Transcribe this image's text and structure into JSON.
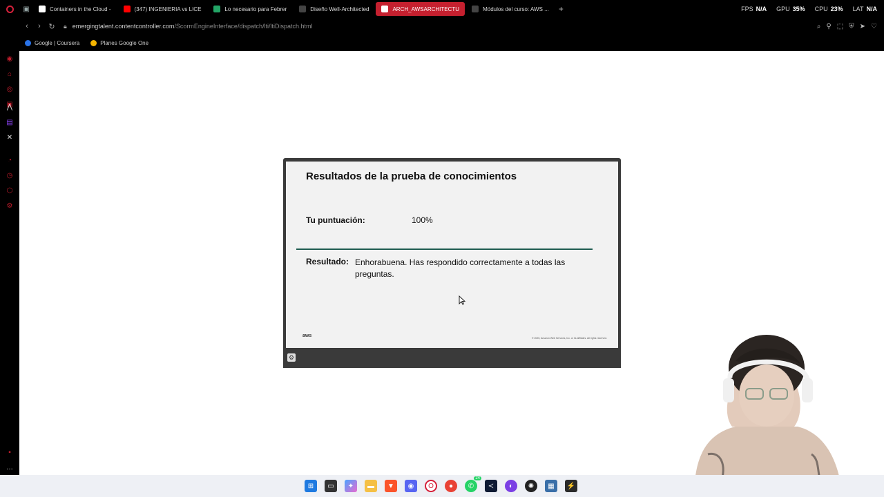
{
  "tabs": [
    {
      "label": "Containers in the Cloud -",
      "color": "#ffffff",
      "icon": "google-icon"
    },
    {
      "label": "(347) INGENIERIA vs LICE",
      "color": "#ff0000",
      "icon": "youtube-icon"
    },
    {
      "label": "Lo necesario para Febrer",
      "color": "#23a566",
      "icon": "sheets-icon"
    },
    {
      "label": "Diseño Well-Architected",
      "color": "#666666",
      "icon": "doc-icon"
    },
    {
      "label": "ARCH_AWSARCHITECTU",
      "color": "#ffffff",
      "icon": "page-icon",
      "active": true
    },
    {
      "label": "Módulos del curso: AWS ...",
      "color": "#666666",
      "icon": "doc-icon"
    }
  ],
  "hardware": {
    "fps_label": "FPS",
    "fps_value": "N/A",
    "gpu_label": "GPU",
    "gpu_value": "35%",
    "cpu_label": "CPU",
    "cpu_value": "23%",
    "lat_label": "LAT",
    "lat_value": "N/A"
  },
  "address": {
    "host": "emergingtalent.contentcontroller.com",
    "path": "/ScormEngineInterface/dispatch/lti/ltiDispatch.html"
  },
  "bookmarks": [
    {
      "label": "Google | Coursera",
      "color": "#2a73e8"
    },
    {
      "label": "Planes Google One",
      "color": "#f4b400"
    }
  ],
  "slide": {
    "title": "Resultados de la prueba de conocimientos",
    "score_label": "Tu puntuación:",
    "score_value": "100%",
    "result_label": "Resultado:",
    "result_text": "Enhorabuena. Has respondido correctamente a todas las preguntas.",
    "logo": "aws",
    "copyright": "© 2025, Amazon Web Services, Inc. or its affiliates. All rights reserved."
  },
  "taskbar": {
    "icons": [
      "windows-icon",
      "taskview-icon",
      "copilot-icon",
      "explorer-icon",
      "brave-icon",
      "discord-icon",
      "opera-gx-icon",
      "chrome-icon",
      "whatsapp-icon",
      "vscode-icon",
      "podcast-icon",
      "davinci-icon",
      "calculator-icon",
      "terminal-icon"
    ],
    "whatsapp_badge": "24"
  }
}
